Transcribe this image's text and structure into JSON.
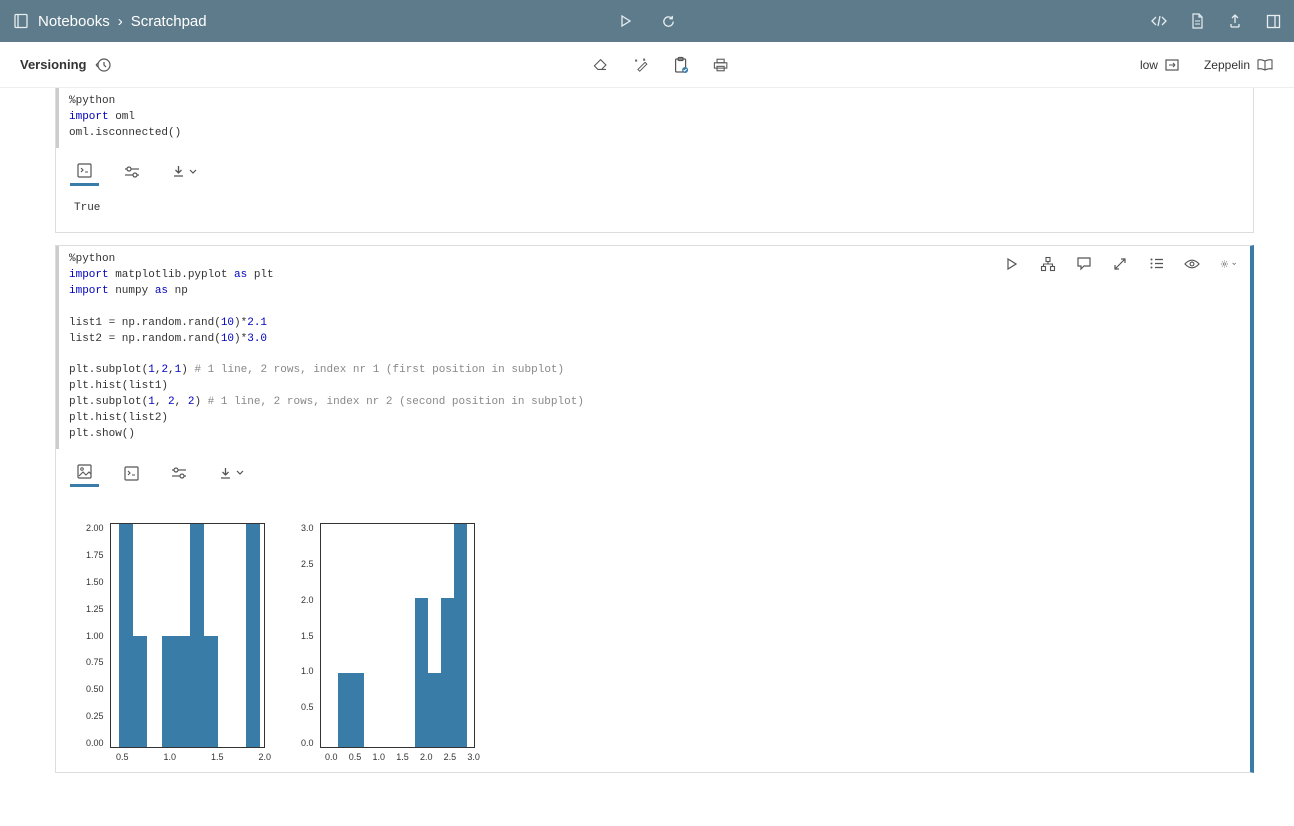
{
  "breadcrumb": {
    "root": "Notebooks",
    "sep": "›",
    "page": "Scratchpad"
  },
  "subbar": {
    "versioning": "Versioning",
    "mode": "low",
    "engine": "Zeppelin"
  },
  "cell1": {
    "code": {
      "l1a": "%python",
      "l2a": "import",
      "l2b": " oml",
      "l3a": "oml.isconnected()"
    },
    "output": "True"
  },
  "cell2": {
    "code": {
      "l1": "%python",
      "l2a": "import",
      "l2b": " matplotlib.pyplot ",
      "l2c": "as",
      "l2d": " plt",
      "l3a": "import",
      "l3b": " numpy ",
      "l3c": "as",
      "l3d": " np",
      "blank1": "",
      "l4a": "list1 = np.random.rand(",
      "l4b": "10",
      "l4c": ")*",
      "l4d": "2.1",
      "l5a": "list2 = np.random.rand(",
      "l5b": "10",
      "l5c": ")*",
      "l5d": "3.0",
      "blank2": "",
      "l6a": "plt.subplot(",
      "l6b": "1",
      "l6c": ",",
      "l6d": "2",
      "l6e": ",",
      "l6f": "1",
      "l6g": ") ",
      "l6h": "# 1 line, 2 rows, index nr 1 (first position in subplot)",
      "l7": "plt.hist(list1)",
      "l8a": "plt.subplot(",
      "l8b": "1",
      "l8c": ", ",
      "l8d": "2",
      "l8e": ", ",
      "l8f": "2",
      "l8g": ") ",
      "l8h": "# 1 line, 2 rows, index nr 2 (second position in subplot)",
      "l9": "plt.hist(list2)",
      "l10": "plt.show()"
    }
  },
  "chart_data": [
    {
      "type": "bar",
      "yticks": [
        "2.00",
        "1.75",
        "1.50",
        "1.25",
        "1.00",
        "0.75",
        "0.50",
        "0.25",
        "0.00"
      ],
      "xticks": [
        "0.5",
        "1.0",
        "1.5",
        "2.0"
      ],
      "ylim": [
        0,
        2.0
      ],
      "bins": [
        {
          "x0": 0.28,
          "x1": 0.47,
          "h": 2.0
        },
        {
          "x0": 0.47,
          "x1": 0.66,
          "h": 1.0
        },
        {
          "x0": 0.66,
          "x1": 0.85,
          "h": 0.0
        },
        {
          "x0": 0.85,
          "x1": 1.04,
          "h": 1.0
        },
        {
          "x0": 1.04,
          "x1": 1.23,
          "h": 1.0
        },
        {
          "x0": 1.23,
          "x1": 1.42,
          "h": 2.0
        },
        {
          "x0": 1.42,
          "x1": 1.61,
          "h": 1.0
        },
        {
          "x0": 1.61,
          "x1": 1.8,
          "h": 0.0
        },
        {
          "x0": 1.8,
          "x1": 1.99,
          "h": 0.0
        },
        {
          "x0": 1.99,
          "x1": 2.18,
          "h": 2.0
        }
      ],
      "xrange": [
        0.16,
        2.23
      ]
    },
    {
      "type": "bar",
      "yticks": [
        "3.0",
        "2.5",
        "2.0",
        "1.5",
        "1.0",
        "0.5",
        "0.0"
      ],
      "xticks": [
        "0.0",
        "0.5",
        "1.0",
        "1.5",
        "2.0",
        "2.5",
        "3.0"
      ],
      "ylim": [
        0,
        3.0
      ],
      "bins": [
        {
          "x0": 0.26,
          "x1": 0.53,
          "h": 1.0
        },
        {
          "x0": 0.53,
          "x1": 0.8,
          "h": 1.0
        },
        {
          "x0": 0.8,
          "x1": 1.07,
          "h": 0.0
        },
        {
          "x0": 1.07,
          "x1": 1.34,
          "h": 0.0
        },
        {
          "x0": 1.34,
          "x1": 1.61,
          "h": 0.0
        },
        {
          "x0": 1.61,
          "x1": 1.88,
          "h": 0.0
        },
        {
          "x0": 1.88,
          "x1": 2.15,
          "h": 2.0
        },
        {
          "x0": 2.15,
          "x1": 2.42,
          "h": 1.0
        },
        {
          "x0": 2.42,
          "x1": 2.69,
          "h": 2.0
        },
        {
          "x0": 2.69,
          "x1": 2.96,
          "h": 3.0
        }
      ],
      "xrange": [
        -0.1,
        3.1
      ]
    }
  ]
}
